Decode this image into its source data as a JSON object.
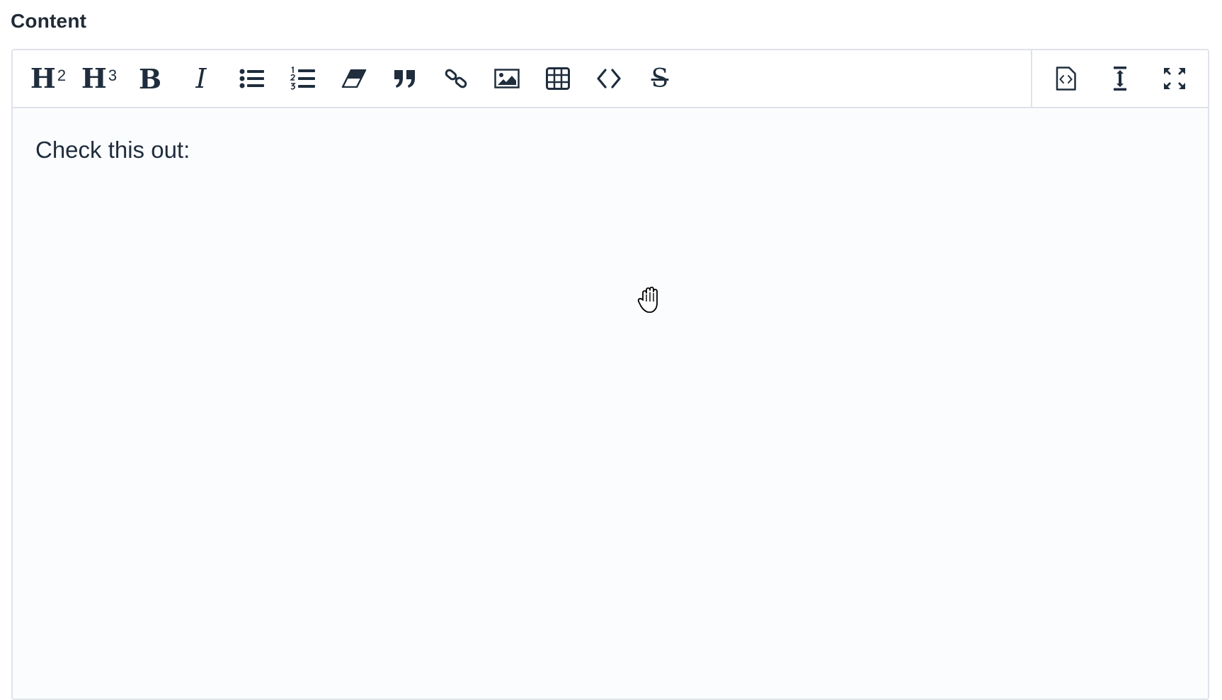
{
  "field": {
    "label": "Content"
  },
  "toolbar": {
    "left": [
      {
        "id": "h2",
        "icon": "heading-2-icon",
        "text": "H",
        "sup": "2"
      },
      {
        "id": "h3",
        "icon": "heading-3-icon",
        "text": "H",
        "sup": "3"
      },
      {
        "id": "bold",
        "icon": "bold-icon",
        "text": "B"
      },
      {
        "id": "italic",
        "icon": "italic-icon",
        "text": "I"
      },
      {
        "id": "bullet-list",
        "icon": "bullet-list-icon"
      },
      {
        "id": "ordered-list",
        "icon": "ordered-list-icon"
      },
      {
        "id": "clear-format",
        "icon": "eraser-icon"
      },
      {
        "id": "quote",
        "icon": "quote-icon"
      },
      {
        "id": "link",
        "icon": "link-icon"
      },
      {
        "id": "image",
        "icon": "image-icon"
      },
      {
        "id": "table",
        "icon": "table-icon"
      },
      {
        "id": "code",
        "icon": "code-icon"
      },
      {
        "id": "strikethrough",
        "icon": "strikethrough-icon",
        "text": "S"
      }
    ],
    "right": [
      {
        "id": "source",
        "icon": "source-code-icon"
      },
      {
        "id": "resize",
        "icon": "resize-vertical-icon"
      },
      {
        "id": "fullscreen",
        "icon": "fullscreen-icon"
      }
    ]
  },
  "editor": {
    "content": "Check this out:"
  },
  "cursor": {
    "icon": "grab-hand-icon"
  },
  "colors": {
    "text": "#1f2d3d",
    "border": "#dfe3e8",
    "editor_bg": "#fbfcfe"
  }
}
